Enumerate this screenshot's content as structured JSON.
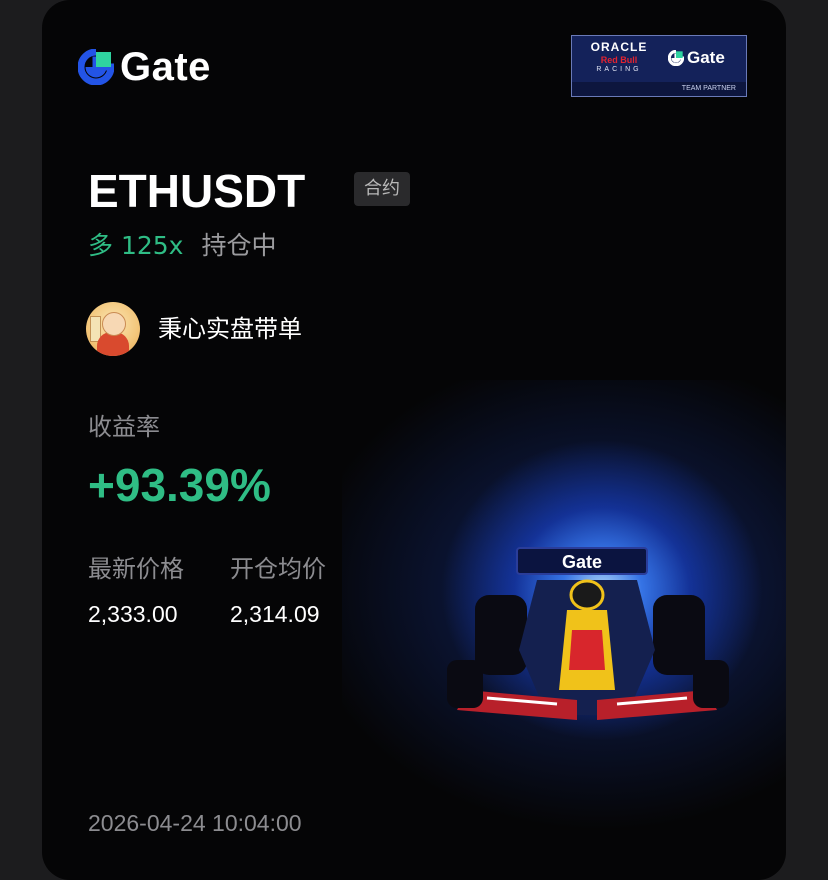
{
  "brand": {
    "name": "Gate",
    "accent_color": "#2354e6",
    "partner_badge": {
      "line1": "ORACLE",
      "line2": "Red Bull",
      "line3": "RACING",
      "brand": "Gate",
      "caption": "TEAM PARTNER"
    }
  },
  "position": {
    "symbol": "ETHUSDT",
    "type_tag": "合约",
    "side_leverage": "多 125x",
    "status": "持仓中",
    "side_color": "#2fbd85"
  },
  "trader": {
    "name": "秉心实盘带单"
  },
  "roi": {
    "label": "收益率",
    "value": "+93.39%"
  },
  "prices": {
    "latest_label": "最新价格",
    "latest_value": "2,333.00",
    "entry_label": "开仓均价",
    "entry_value": "2,314.09"
  },
  "timestamp": "2026-04-24 10:04:00",
  "car_wing_text": "Gate"
}
